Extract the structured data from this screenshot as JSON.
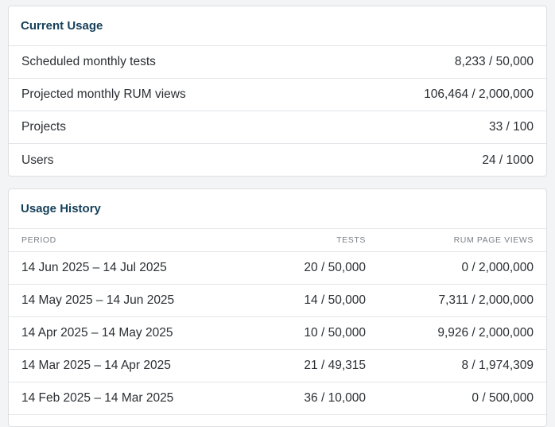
{
  "current_usage": {
    "title": "Current Usage",
    "rows": [
      {
        "label": "Scheduled monthly tests",
        "value": "8,233 / 50,000"
      },
      {
        "label": "Projected monthly RUM views",
        "value": "106,464 / 2,000,000"
      },
      {
        "label": "Projects",
        "value": "33 / 100"
      },
      {
        "label": "Users",
        "value": "24 / 1000"
      }
    ]
  },
  "usage_history": {
    "title": "Usage History",
    "columns": {
      "period": "PERIOD",
      "tests": "TESTS",
      "rum": "RUM PAGE VIEWS"
    },
    "rows": [
      {
        "period": "14 Jun 2025 – 14 Jul 2025",
        "tests": "20 / 50,000",
        "rum": "0 / 2,000,000"
      },
      {
        "period": "14 May 2025 – 14 Jun 2025",
        "tests": "14 / 50,000",
        "rum": "7,311 / 2,000,000"
      },
      {
        "period": "14 Apr 2025 – 14 May 2025",
        "tests": "10 / 50,000",
        "rum": "9,926 / 2,000,000"
      },
      {
        "period": "14 Mar 2025 – 14 Apr 2025",
        "tests": "21 / 49,315",
        "rum": "8 / 1,974,309"
      },
      {
        "period": "14 Feb 2025 – 14 Mar 2025",
        "tests": "36 / 10,000",
        "rum": "0 / 500,000"
      }
    ]
  }
}
